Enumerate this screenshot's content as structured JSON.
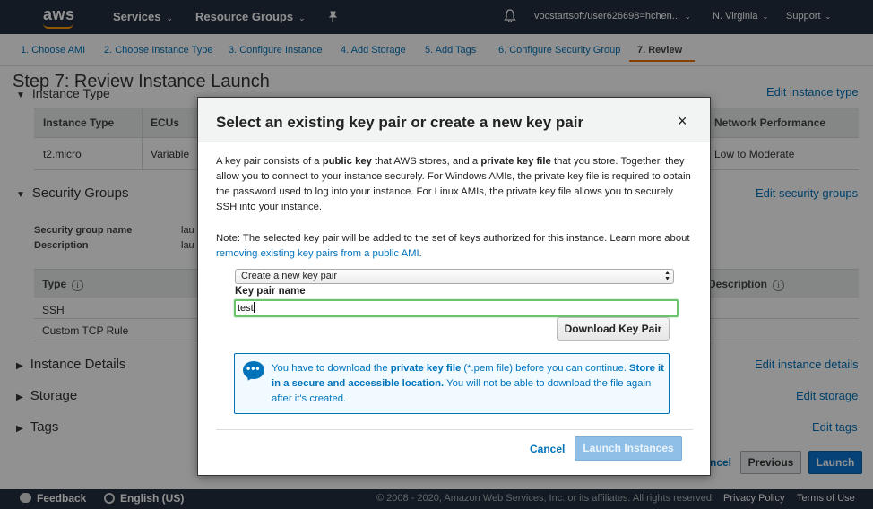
{
  "topnav": {
    "logo": "aws",
    "services": "Services",
    "resource_groups": "Resource Groups",
    "account": "vocstartsoft/user626698=hchen...",
    "region": "N. Virginia",
    "support": "Support"
  },
  "wizard": {
    "steps": [
      "1. Choose AMI",
      "2. Choose Instance Type",
      "3. Configure Instance",
      "4. Add Storage",
      "5. Add Tags",
      "6. Configure Security Group",
      "7. Review"
    ]
  },
  "page": {
    "title": "Step 7: Review Instance Launch",
    "instance_type_section": "Instance Type",
    "edit_instance_type": "Edit instance type",
    "table_headers": {
      "instance_type": "Instance Type",
      "ecus": "ECUs",
      "network_performance": "Network Performance"
    },
    "table_row": {
      "instance_type": "t2.micro",
      "ecus": "Variable",
      "network_performance": "Low to Moderate"
    },
    "security_groups": "Security Groups",
    "edit_security_groups": "Edit security groups",
    "sg_name_label": "Security group name",
    "sg_name_value": "lau",
    "sg_desc_label": "Description",
    "sg_desc_value": "lau",
    "sg_headers": {
      "type": "Type",
      "description": "Description"
    },
    "sg_rows": [
      "SSH",
      "Custom TCP Rule"
    ],
    "instance_details": "Instance Details",
    "edit_instance_details": "Edit instance details",
    "storage": "Storage",
    "edit_storage": "Edit storage",
    "tags": "Tags",
    "edit_tags": "Edit tags",
    "cancel_partial": "ncel",
    "previous": "Previous",
    "launch": "Launch"
  },
  "modal": {
    "title": "Select an existing key pair or create a new key pair",
    "close": "×",
    "para1": {
      "t1": "A key pair consists of a ",
      "b1": "public key",
      "t2": " that AWS stores, and a ",
      "b2": "private key file",
      "t3": " that you store. Together, they allow you to connect to your instance securely. For Windows AMIs, the private key file is required to obtain the password used to log into your instance. For Linux AMIs, the private key file allows you to securely SSH into your instance."
    },
    "para2": {
      "t1": "Note: The selected key pair will be added to the set of keys authorized for this instance. Learn more about ",
      "link": "removing existing key pairs from a public AMI",
      "t2": "."
    },
    "select_value": "Create a new key pair",
    "key_pair_label": "Key pair name",
    "key_pair_value": "test",
    "download_button": "Download Key Pair",
    "info": {
      "t1": "You have to download the ",
      "b1": "private key file",
      "t2": " (*.pem file) before you can continue. ",
      "b2": "Store it in a secure and accessible location.",
      "t3": " You will not be able to download the file again after it's created."
    },
    "cancel": "Cancel",
    "launch_instances": "Launch Instances"
  },
  "footer": {
    "feedback": "Feedback",
    "language": "English (US)",
    "copyright": "© 2008 - 2020, Amazon Web Services, Inc. or its affiliates. All rights reserved.",
    "privacy": "Privacy Policy",
    "terms": "Terms of Use"
  }
}
